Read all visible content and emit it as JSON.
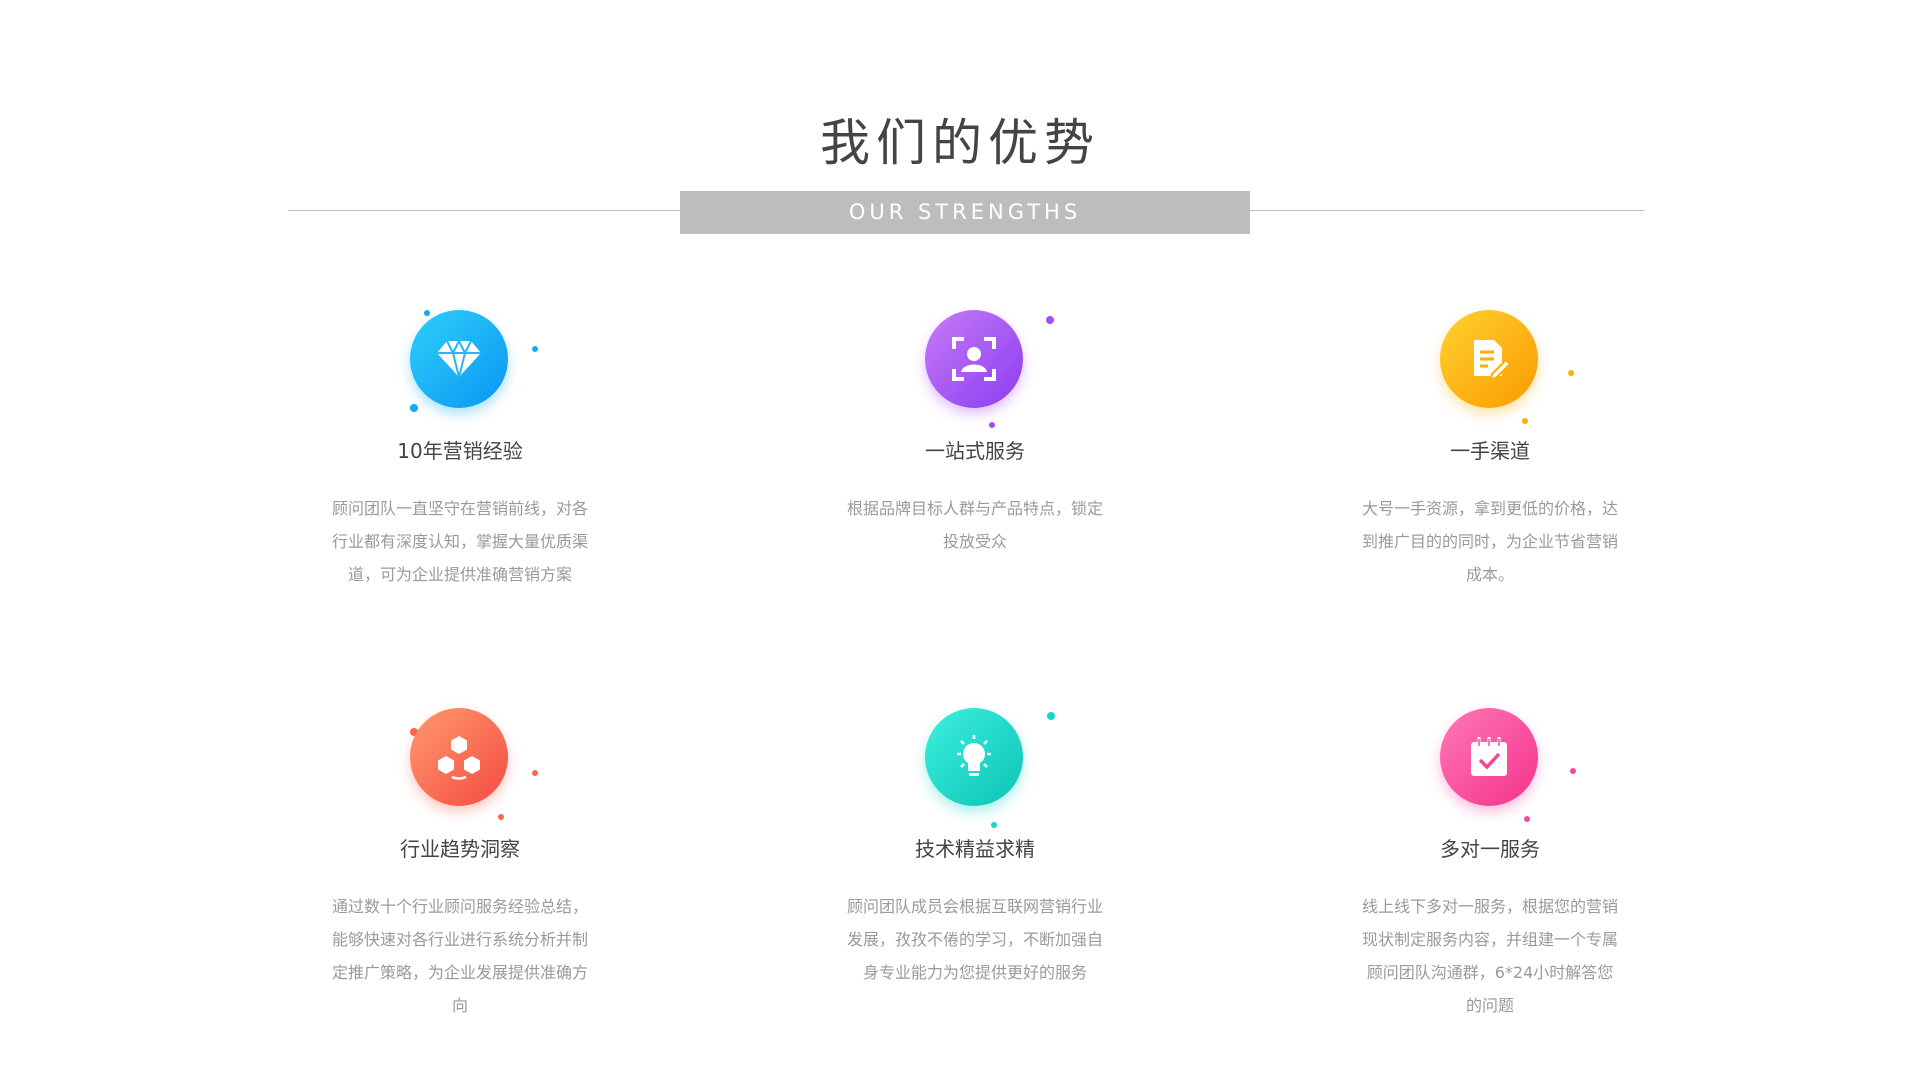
{
  "header": {
    "title": "我们的优势",
    "subtitle": "OUR STRENGTHS"
  },
  "cards": [
    {
      "icon": "diamond-icon",
      "color": "#14aaf5",
      "title": "10年营销经验",
      "desc": "顾问团队一直坚守在营销前线，对各行业都有深度认知，掌握大量优质渠道，可为企业提供准确营销方案"
    },
    {
      "icon": "face-scan-icon",
      "color": "#a24ef2",
      "title": "一站式服务",
      "desc": "根据品牌目标人群与产品特点，锁定投放受众"
    },
    {
      "icon": "document-edit-icon",
      "color": "#fbb006",
      "title": "一手渠道",
      "desc": "大号一手资源，拿到更低的价格，达到推广目的的同时，为企业节省营销成本。"
    },
    {
      "icon": "cubes-icon",
      "color": "#f8684e",
      "title": "行业趋势洞察",
      "desc": "通过数十个行业顾问服务经验总结，能够快速对各行业进行系统分析并制定推广策略，为企业发展提供准确方向"
    },
    {
      "icon": "lightbulb-icon",
      "color": "#12d8c6",
      "title": "技术精益求精",
      "desc": "顾问团队成员会根据互联网营销行业发展，孜孜不倦的学习，不断加强自身专业能力为您提供更好的服务"
    },
    {
      "icon": "calendar-check-icon",
      "color": "#f9479d",
      "title": "多对一服务",
      "desc": "线上线下多对一服务，根据您的营销现状制定服务内容，并组建一个专属顾问团队沟通群，6*24小时解答您的问题"
    }
  ]
}
